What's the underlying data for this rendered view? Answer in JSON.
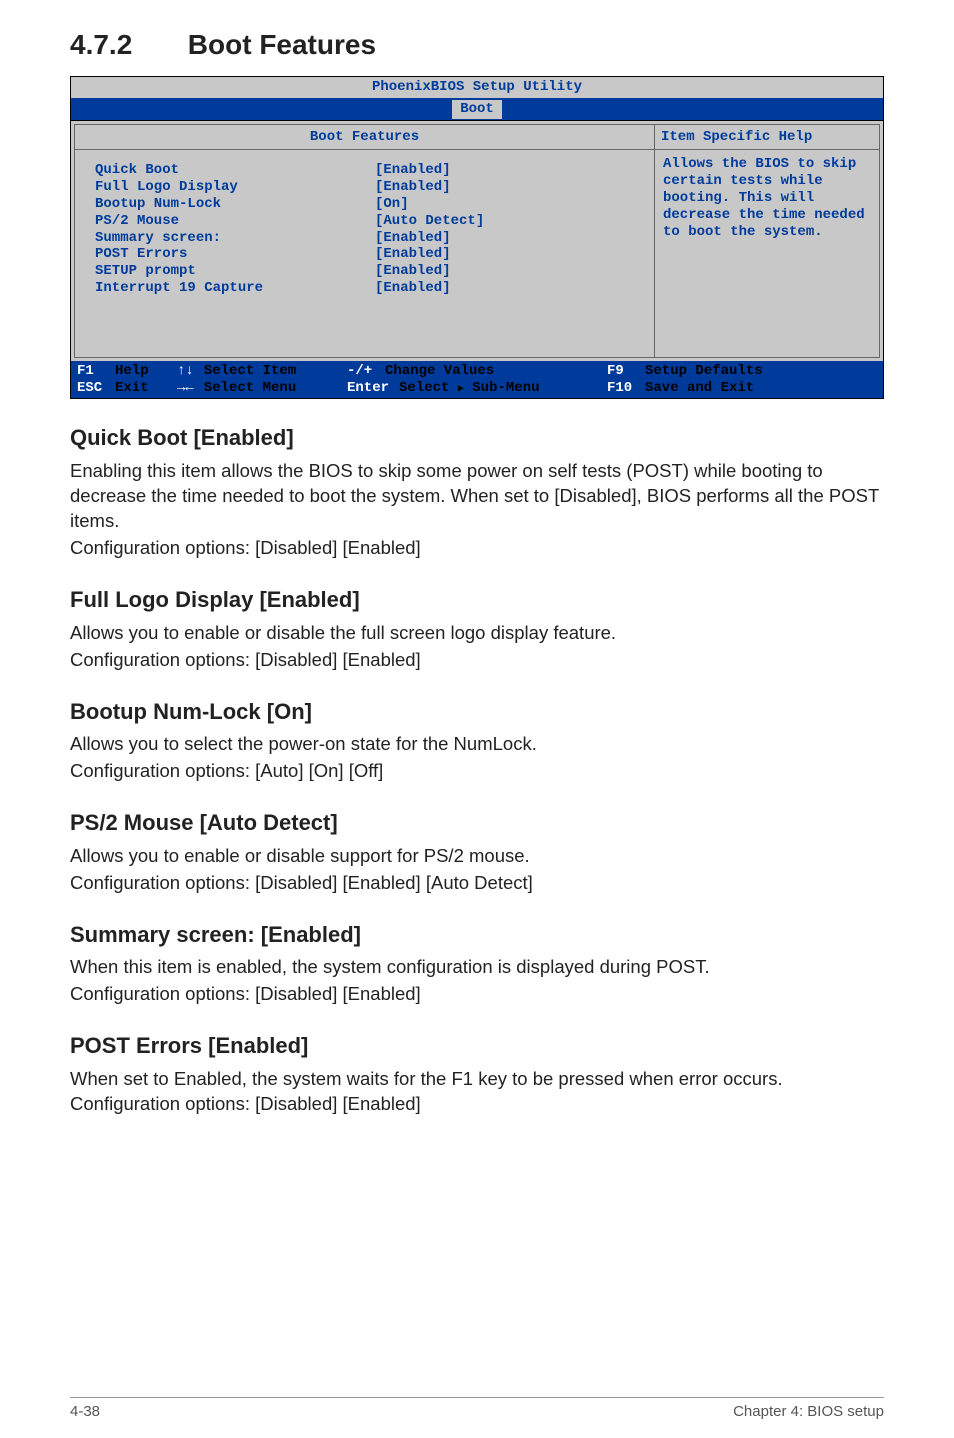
{
  "heading": {
    "number": "4.7.2",
    "title": "Boot Features"
  },
  "bios": {
    "title": "PhoenixBIOS Setup Utility",
    "tab": "Boot",
    "panelHeader": "Boot Features",
    "helpHeader": "Item Specific Help",
    "items": [
      {
        "label": "Quick Boot",
        "value": "[Enabled]"
      },
      {
        "label": "Full Logo Display",
        "value": "[Enabled]"
      },
      {
        "label": "Bootup Num-Lock",
        "value": "[On]"
      },
      {
        "label": "PS/2 Mouse",
        "value": "[Auto Detect]"
      },
      {
        "label": "Summary screen:",
        "value": "[Enabled]"
      },
      {
        "label": "POST Errors",
        "value": "[Enabled]"
      },
      {
        "label": "SETUP prompt",
        "value": "[Enabled]"
      },
      {
        "label": "Interrupt 19 Capture",
        "value": "[Enabled]"
      }
    ],
    "helpText": "Allows the BIOS to skip certain tests while booting. This will decrease the time needed to boot the system.",
    "footer": {
      "row1": {
        "k1": "F1",
        "d1": "Help",
        "s2": "↑↓",
        "d2": "Select Item",
        "k3": "-/+",
        "d3": "Change Values",
        "k4": "F9",
        "d4": "Setup Defaults"
      },
      "row2": {
        "k1": "ESC",
        "d1": "Exit",
        "s2": "→←",
        "d2": "Select Menu",
        "k3": "Enter",
        "d3a": "Select",
        "d3b": "Sub-Menu",
        "k4": "F10",
        "d4": "Save and Exit"
      }
    }
  },
  "sections": [
    {
      "title": "Quick Boot [Enabled]",
      "paras": [
        "Enabling this item allows the BIOS to skip some power on self tests (POST) while booting to decrease the time needed to boot the system. When set to [Disabled], BIOS performs all the POST items.",
        "Configuration options: [Disabled] [Enabled]"
      ]
    },
    {
      "title": "Full Logo Display [Enabled]",
      "paras": [
        "Allows you to enable or disable the full screen logo display feature.",
        "Configuration options: [Disabled] [Enabled]"
      ]
    },
    {
      "title": "Bootup Num-Lock [On]",
      "paras": [
        "Allows you to select the power-on state for the NumLock.",
        "Configuration options: [Auto] [On] [Off]"
      ]
    },
    {
      "title": "PS/2 Mouse [Auto Detect]",
      "paras": [
        "Allows you to enable or disable support for PS/2 mouse.",
        "Configuration options: [Disabled] [Enabled] [Auto Detect]"
      ]
    },
    {
      "title": "Summary screen: [Enabled]",
      "paras": [
        "When this item is enabled, the system configuration is displayed during POST.",
        "Configuration options: [Disabled] [Enabled]"
      ]
    },
    {
      "title": "POST Errors [Enabled]",
      "paras": [
        "When set to Enabled, the system waits for the F1 key to be pressed when error occurs. Configuration options: [Disabled] [Enabled]"
      ]
    }
  ],
  "footer": {
    "left": "4-38",
    "right": "Chapter 4: BIOS setup"
  }
}
